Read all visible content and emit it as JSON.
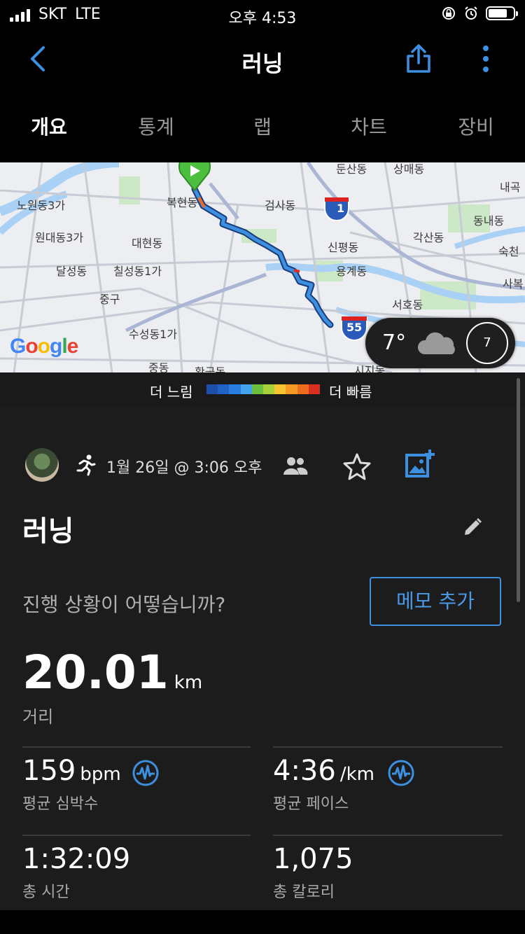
{
  "status_bar": {
    "carrier": "SKT",
    "network": "LTE",
    "time": "오후 4:53"
  },
  "header": {
    "title": "러닝"
  },
  "tabs": [
    "개요",
    "통계",
    "랩",
    "차트",
    "장비"
  ],
  "map": {
    "labels": [
      "노원동3가",
      "원대동3가",
      "대현동",
      "달성동",
      "칠성동1가",
      "중구",
      "수성동1가",
      "중동",
      "복현동",
      "검사동",
      "신평동",
      "용계동",
      "서호동",
      "각산동",
      "동내동",
      "숙천",
      "사복",
      "내곡",
      "둔산동",
      "상매동",
      "시지동",
      "황금동"
    ],
    "highway_labels": [
      "1",
      "55"
    ],
    "logo": "Google"
  },
  "weather": {
    "temperature": "7°",
    "wind_speed": "7"
  },
  "pace_legend": {
    "slow_label": "더 느림",
    "fast_label": "더 빠름",
    "colors": [
      "#1b4fa8",
      "#1f63c4",
      "#2a7de0",
      "#43a3ec",
      "#6bbf3f",
      "#a6d13a",
      "#f4c430",
      "#f59a23",
      "#ee6a1c",
      "#d92f1e"
    ]
  },
  "activity": {
    "date": "1월 26일 @ 3:06 오후",
    "title": "러닝",
    "prompt": "진행 상황이 어떻습니까?",
    "memo_button": "메모 추가"
  },
  "stats": {
    "distance": {
      "value": "20.01",
      "unit": "km",
      "label": "거리"
    },
    "avg_hr": {
      "value": "159",
      "unit": "bpm",
      "label": "평균 심박수"
    },
    "avg_pace": {
      "value": "4:36",
      "unit": "/km",
      "label": "평균 페이스"
    },
    "total_time": {
      "value": "1:32:09",
      "label": "총 시간"
    },
    "calories": {
      "value": "1,075",
      "label": "총 칼로리"
    }
  },
  "colors": {
    "accent": "#3d8fe0",
    "background": "#000000",
    "card": "#1c1c1c"
  }
}
